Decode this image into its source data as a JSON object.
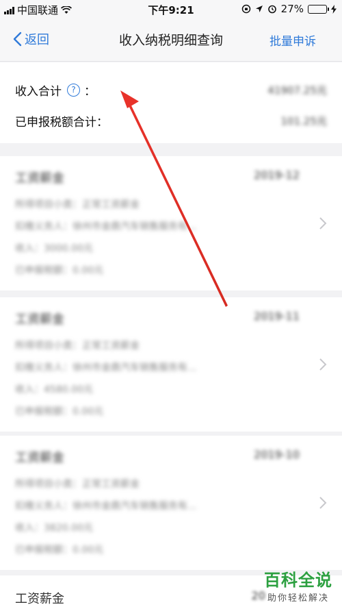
{
  "status_bar": {
    "carrier": "中国联通",
    "time": "下午9:21",
    "battery": "27%",
    "battery_level": 0.27
  },
  "nav": {
    "back_label": "返回",
    "title": "收入纳税明细查询",
    "action_label": "批量申诉"
  },
  "summary": {
    "income_label": "收入合计",
    "income_colon": "：",
    "income_value": "41907.25元",
    "tax_label": "已申报税额合计：",
    "tax_value": "101.25元"
  },
  "records": [
    {
      "title": "工资薪金",
      "date": "2019-12",
      "item": "所得项目小类：正常工资薪金",
      "payer": "扣缴义务人：徐州市金鼎汽车销售服务有...",
      "income": "收入：3000.00元",
      "tax": "已申报税额：0.00元"
    },
    {
      "title": "工资薪金",
      "date": "2019-11",
      "item": "所得项目小类：正常工资薪金",
      "payer": "扣缴义务人：徐州市金鼎汽车销售服务有...",
      "income": "收入：4580.00元",
      "tax": "已申报税额：0.00元"
    },
    {
      "title": "工资薪金",
      "date": "2019-10",
      "item": "所得项目小类：正常工资薪金",
      "payer": "扣缴义务人：徐州市金鼎汽车销售服务有...",
      "income": "收入：3820.00元",
      "tax": "已申报税额：0.00元"
    },
    {
      "title": "工资薪金",
      "date": "20"
    }
  ],
  "watermark": {
    "main": "百科全说",
    "sub": "助你轻松解决"
  },
  "colors": {
    "accent": "#2f7ad9",
    "arrow": "#e8322a",
    "watermark": "#2ca040"
  }
}
